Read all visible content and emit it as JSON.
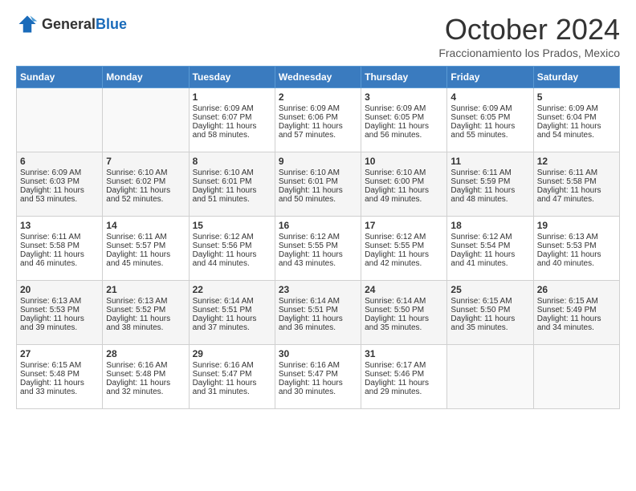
{
  "header": {
    "logo_general": "General",
    "logo_blue": "Blue",
    "month_title": "October 2024",
    "subtitle": "Fraccionamiento los Prados, Mexico"
  },
  "days_of_week": [
    "Sunday",
    "Monday",
    "Tuesday",
    "Wednesday",
    "Thursday",
    "Friday",
    "Saturday"
  ],
  "weeks": [
    [
      {
        "day": "",
        "sunrise": "",
        "sunset": "",
        "daylight": ""
      },
      {
        "day": "",
        "sunrise": "",
        "sunset": "",
        "daylight": ""
      },
      {
        "day": "1",
        "sunrise": "Sunrise: 6:09 AM",
        "sunset": "Sunset: 6:07 PM",
        "daylight": "Daylight: 11 hours and 58 minutes."
      },
      {
        "day": "2",
        "sunrise": "Sunrise: 6:09 AM",
        "sunset": "Sunset: 6:06 PM",
        "daylight": "Daylight: 11 hours and 57 minutes."
      },
      {
        "day": "3",
        "sunrise": "Sunrise: 6:09 AM",
        "sunset": "Sunset: 6:05 PM",
        "daylight": "Daylight: 11 hours and 56 minutes."
      },
      {
        "day": "4",
        "sunrise": "Sunrise: 6:09 AM",
        "sunset": "Sunset: 6:05 PM",
        "daylight": "Daylight: 11 hours and 55 minutes."
      },
      {
        "day": "5",
        "sunrise": "Sunrise: 6:09 AM",
        "sunset": "Sunset: 6:04 PM",
        "daylight": "Daylight: 11 hours and 54 minutes."
      }
    ],
    [
      {
        "day": "6",
        "sunrise": "Sunrise: 6:09 AM",
        "sunset": "Sunset: 6:03 PM",
        "daylight": "Daylight: 11 hours and 53 minutes."
      },
      {
        "day": "7",
        "sunrise": "Sunrise: 6:10 AM",
        "sunset": "Sunset: 6:02 PM",
        "daylight": "Daylight: 11 hours and 52 minutes."
      },
      {
        "day": "8",
        "sunrise": "Sunrise: 6:10 AM",
        "sunset": "Sunset: 6:01 PM",
        "daylight": "Daylight: 11 hours and 51 minutes."
      },
      {
        "day": "9",
        "sunrise": "Sunrise: 6:10 AM",
        "sunset": "Sunset: 6:01 PM",
        "daylight": "Daylight: 11 hours and 50 minutes."
      },
      {
        "day": "10",
        "sunrise": "Sunrise: 6:10 AM",
        "sunset": "Sunset: 6:00 PM",
        "daylight": "Daylight: 11 hours and 49 minutes."
      },
      {
        "day": "11",
        "sunrise": "Sunrise: 6:11 AM",
        "sunset": "Sunset: 5:59 PM",
        "daylight": "Daylight: 11 hours and 48 minutes."
      },
      {
        "day": "12",
        "sunrise": "Sunrise: 6:11 AM",
        "sunset": "Sunset: 5:58 PM",
        "daylight": "Daylight: 11 hours and 47 minutes."
      }
    ],
    [
      {
        "day": "13",
        "sunrise": "Sunrise: 6:11 AM",
        "sunset": "Sunset: 5:58 PM",
        "daylight": "Daylight: 11 hours and 46 minutes."
      },
      {
        "day": "14",
        "sunrise": "Sunrise: 6:11 AM",
        "sunset": "Sunset: 5:57 PM",
        "daylight": "Daylight: 11 hours and 45 minutes."
      },
      {
        "day": "15",
        "sunrise": "Sunrise: 6:12 AM",
        "sunset": "Sunset: 5:56 PM",
        "daylight": "Daylight: 11 hours and 44 minutes."
      },
      {
        "day": "16",
        "sunrise": "Sunrise: 6:12 AM",
        "sunset": "Sunset: 5:55 PM",
        "daylight": "Daylight: 11 hours and 43 minutes."
      },
      {
        "day": "17",
        "sunrise": "Sunrise: 6:12 AM",
        "sunset": "Sunset: 5:55 PM",
        "daylight": "Daylight: 11 hours and 42 minutes."
      },
      {
        "day": "18",
        "sunrise": "Sunrise: 6:12 AM",
        "sunset": "Sunset: 5:54 PM",
        "daylight": "Daylight: 11 hours and 41 minutes."
      },
      {
        "day": "19",
        "sunrise": "Sunrise: 6:13 AM",
        "sunset": "Sunset: 5:53 PM",
        "daylight": "Daylight: 11 hours and 40 minutes."
      }
    ],
    [
      {
        "day": "20",
        "sunrise": "Sunrise: 6:13 AM",
        "sunset": "Sunset: 5:53 PM",
        "daylight": "Daylight: 11 hours and 39 minutes."
      },
      {
        "day": "21",
        "sunrise": "Sunrise: 6:13 AM",
        "sunset": "Sunset: 5:52 PM",
        "daylight": "Daylight: 11 hours and 38 minutes."
      },
      {
        "day": "22",
        "sunrise": "Sunrise: 6:14 AM",
        "sunset": "Sunset: 5:51 PM",
        "daylight": "Daylight: 11 hours and 37 minutes."
      },
      {
        "day": "23",
        "sunrise": "Sunrise: 6:14 AM",
        "sunset": "Sunset: 5:51 PM",
        "daylight": "Daylight: 11 hours and 36 minutes."
      },
      {
        "day": "24",
        "sunrise": "Sunrise: 6:14 AM",
        "sunset": "Sunset: 5:50 PM",
        "daylight": "Daylight: 11 hours and 35 minutes."
      },
      {
        "day": "25",
        "sunrise": "Sunrise: 6:15 AM",
        "sunset": "Sunset: 5:50 PM",
        "daylight": "Daylight: 11 hours and 35 minutes."
      },
      {
        "day": "26",
        "sunrise": "Sunrise: 6:15 AM",
        "sunset": "Sunset: 5:49 PM",
        "daylight": "Daylight: 11 hours and 34 minutes."
      }
    ],
    [
      {
        "day": "27",
        "sunrise": "Sunrise: 6:15 AM",
        "sunset": "Sunset: 5:48 PM",
        "daylight": "Daylight: 11 hours and 33 minutes."
      },
      {
        "day": "28",
        "sunrise": "Sunrise: 6:16 AM",
        "sunset": "Sunset: 5:48 PM",
        "daylight": "Daylight: 11 hours and 32 minutes."
      },
      {
        "day": "29",
        "sunrise": "Sunrise: 6:16 AM",
        "sunset": "Sunset: 5:47 PM",
        "daylight": "Daylight: 11 hours and 31 minutes."
      },
      {
        "day": "30",
        "sunrise": "Sunrise: 6:16 AM",
        "sunset": "Sunset: 5:47 PM",
        "daylight": "Daylight: 11 hours and 30 minutes."
      },
      {
        "day": "31",
        "sunrise": "Sunrise: 6:17 AM",
        "sunset": "Sunset: 5:46 PM",
        "daylight": "Daylight: 11 hours and 29 minutes."
      },
      {
        "day": "",
        "sunrise": "",
        "sunset": "",
        "daylight": ""
      },
      {
        "day": "",
        "sunrise": "",
        "sunset": "",
        "daylight": ""
      }
    ]
  ]
}
